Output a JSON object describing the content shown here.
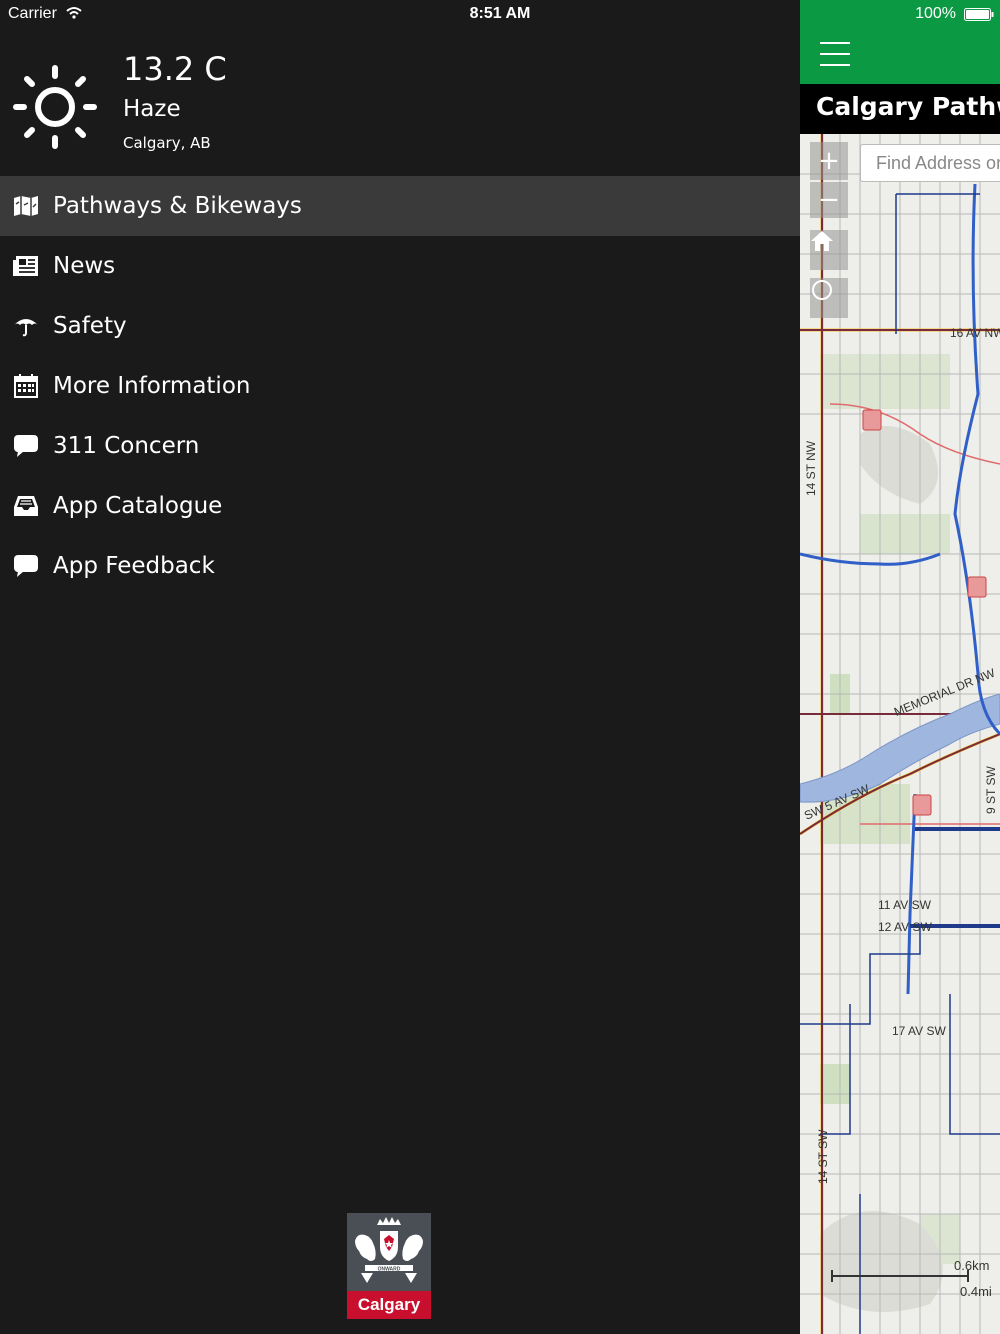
{
  "status_bar": {
    "carrier": "Carrier",
    "time": "8:51 AM",
    "battery": "100%"
  },
  "weather": {
    "temperature": "13.2 C",
    "condition": "Haze",
    "location": "Calgary, AB",
    "icon": "sun-icon"
  },
  "menu": {
    "items": [
      {
        "label": "Pathways & Bikeways",
        "icon": "map-icon",
        "active": true
      },
      {
        "label": "News",
        "icon": "newspaper-icon",
        "active": false
      },
      {
        "label": "Safety",
        "icon": "umbrella-icon",
        "active": false
      },
      {
        "label": "More Information",
        "icon": "calendar-icon",
        "active": false
      },
      {
        "label": "311 Concern",
        "icon": "chat-bubble-icon",
        "active": false
      },
      {
        "label": "App Catalogue",
        "icon": "inbox-tray-icon",
        "active": false
      },
      {
        "label": "App Feedback",
        "icon": "chat-bubble-icon",
        "active": false
      }
    ]
  },
  "logo": {
    "motto": "ONWARD",
    "name": "Calgary"
  },
  "app": {
    "title": "Calgary Pathwa",
    "search_placeholder": "Find Address or",
    "map_labels": {
      "av16": "16 AV NW",
      "st14": "14 ST NW",
      "memorial": "MEMORIAL DR NW",
      "av5": "SW 5 AV SW",
      "st9": "9 ST SW",
      "av11": "11 AV SW",
      "av12": "12 AV SW",
      "av17": "17 AV SW",
      "st14sw": "14 ST SW"
    },
    "scale": {
      "km": "0.6km",
      "mi": "0.4mi"
    },
    "colors": {
      "header": "#0b9a43",
      "pathway": "#2f5fc7",
      "bikeway": "#1f3a8a"
    }
  }
}
